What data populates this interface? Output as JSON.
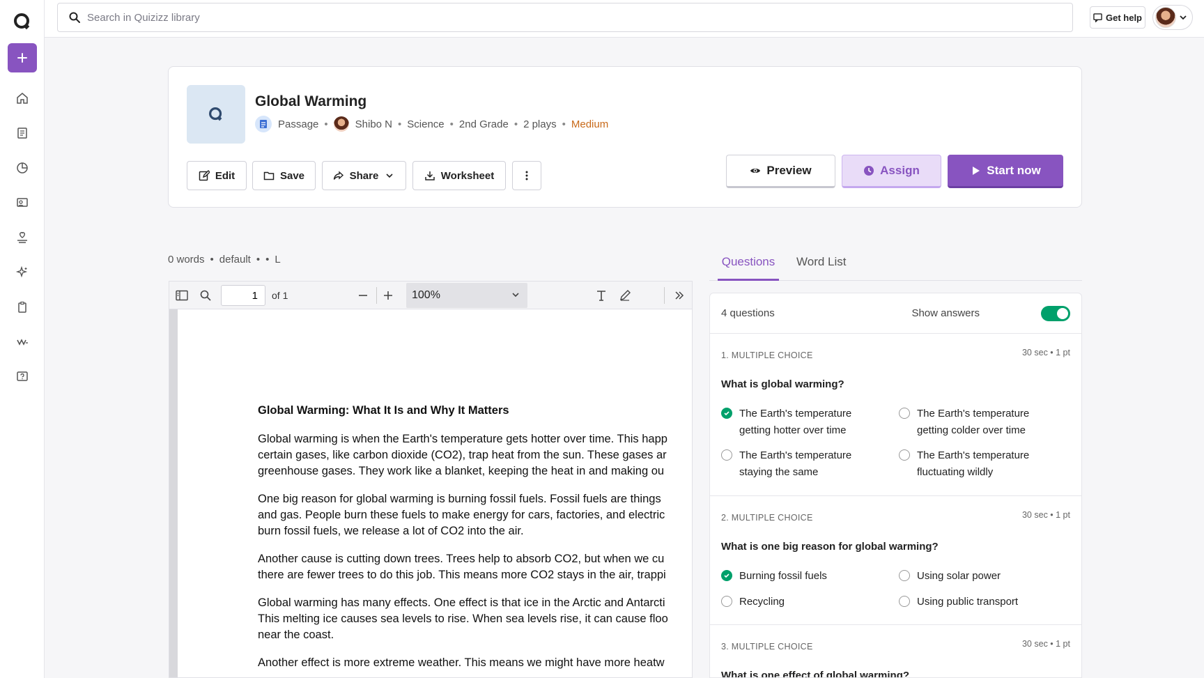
{
  "search": {
    "placeholder": "Search in Quizizz library"
  },
  "topbar": {
    "help_label": "Get help"
  },
  "quiz": {
    "title": "Global Warming",
    "type": "Passage",
    "author": "Shibo N",
    "subject": "Science",
    "grade": "2nd Grade",
    "plays": "2 plays",
    "difficulty": "Medium"
  },
  "actions": {
    "edit": "Edit",
    "save": "Save",
    "share": "Share",
    "worksheet": "Worksheet",
    "preview": "Preview",
    "assign": "Assign",
    "start": "Start now"
  },
  "passage_info": {
    "words": "0 words",
    "style": "default",
    "level": "L"
  },
  "viewer": {
    "page": "1",
    "page_of": "of 1",
    "zoom": "100%"
  },
  "document": {
    "heading": "Global Warming: What It Is and Why It Matters",
    "paragraphs": [
      [
        "Global warming is when the Earth's temperature gets hotter over time. This happ",
        "certain gases, like carbon dioxide (CO2), trap heat from the sun. These gases ar",
        "greenhouse gases. They work like a blanket, keeping the heat in and making ou"
      ],
      [
        "One big reason for global warming is burning fossil fuels. Fossil fuels are things",
        "and gas. People burn these fuels to make energy for cars, factories, and electric",
        "burn fossil fuels, we release a lot of CO2 into the air."
      ],
      [
        "Another cause is cutting down trees. Trees help to absorb CO2, but when we cu",
        "there are fewer trees to do this job. This means more CO2 stays in the air, trappi"
      ],
      [
        "Global warming has many effects. One effect is that ice in the Arctic and Antarcti",
        "This melting ice causes sea levels to rise. When sea levels rise, it can cause floo",
        "near the coast."
      ],
      [
        "Another effect is more extreme weather. This means we might have more heatw"
      ]
    ]
  },
  "tabs": {
    "questions": "Questions",
    "wordlist": "Word List"
  },
  "questions_panel": {
    "count": "4 questions",
    "show_answers": "Show answers",
    "show_answers_on": true,
    "items": [
      {
        "type": "1. MULTIPLE CHOICE",
        "meta": "30 sec • 1 pt",
        "text": "What is global warming?",
        "options": [
          {
            "label": "The Earth's temperature getting hotter over time",
            "correct": true
          },
          {
            "label": "The Earth's temperature getting colder over time",
            "correct": false
          },
          {
            "label": "The Earth's temperature staying the same",
            "correct": false
          },
          {
            "label": "The Earth's temperature fluctuating wildly",
            "correct": false
          }
        ]
      },
      {
        "type": "2. MULTIPLE CHOICE",
        "meta": "30 sec • 1 pt",
        "text": "What is one big reason for global warming?",
        "options": [
          {
            "label": "Burning fossil fuels",
            "correct": true
          },
          {
            "label": "Using solar power",
            "correct": false
          },
          {
            "label": "Recycling",
            "correct": false
          },
          {
            "label": "Using public transport",
            "correct": false
          }
        ]
      },
      {
        "type": "3. MULTIPLE CHOICE",
        "meta": "30 sec • 1 pt",
        "text": "What is one effect of global warming?",
        "options": []
      }
    ]
  },
  "colors": {
    "accent": "#8854c0",
    "correct": "#00a06b",
    "difficulty": "#c86a1a"
  },
  "icons": [
    "quizizz-logo-icon",
    "plus-icon",
    "home-icon",
    "library-icon",
    "reports-icon",
    "classes-icon",
    "accommodations-icon",
    "ai-icon",
    "assessment-icon",
    "quizizz-wordmark-icon",
    "help-icon"
  ]
}
